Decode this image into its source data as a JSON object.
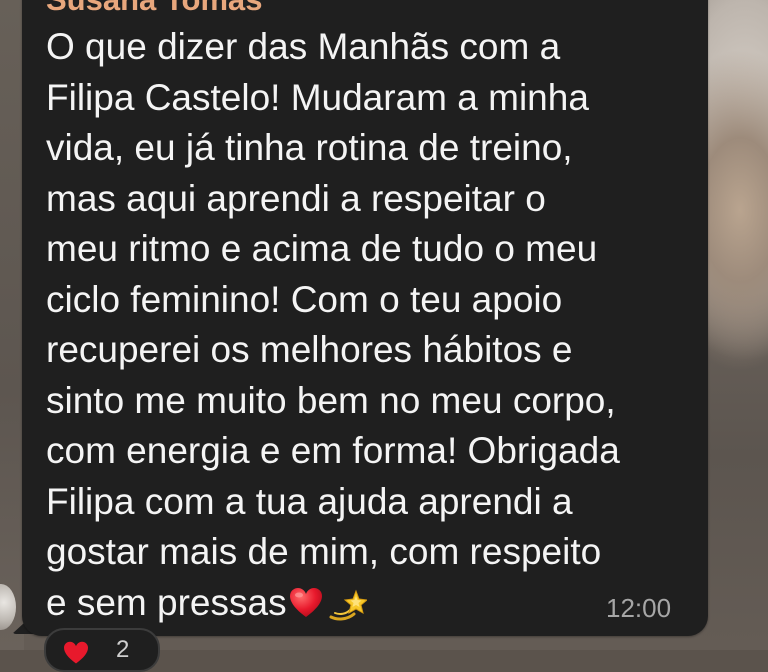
{
  "message": {
    "sender_name": "Susana Tomás",
    "lines": [
      "O que dizer das Manhãs com a",
      "Filipa Castelo! Mudaram a minha",
      "vida, eu já tinha rotina de treino,",
      "mas aqui aprendi a respeitar o",
      "meu ritmo e acima de tudo o meu",
      "ciclo feminino! Com o teu apoio",
      "recuperei os melhores hábitos e",
      "sinto me muito bem no meu corpo,",
      "com energia e em forma! Obrigada",
      "Filipa com a tua ajuda aprendi a",
      "gostar mais de mim, com respeito",
      "e sem pressas"
    ],
    "trailing_emojis": [
      "red-heart-emoji",
      "dizzy-emoji"
    ],
    "timestamp": "12:00"
  },
  "reaction": {
    "emoji": "red-heart-emoji",
    "count": "2"
  },
  "colors": {
    "bubble": "#1f1f1f",
    "text": "#f4f4f4",
    "sender": "#e8a77d",
    "timestamp": "#a6a6a6"
  }
}
